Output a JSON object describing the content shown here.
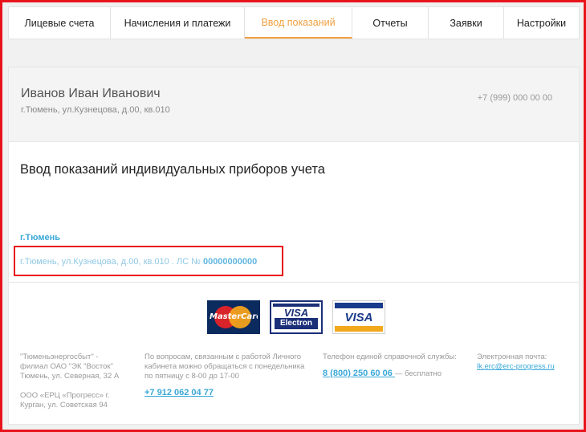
{
  "nav": {
    "tabs": [
      {
        "label": "Лицевые счета"
      },
      {
        "label": "Начисления и платежи"
      },
      {
        "label": "Ввод показаний"
      },
      {
        "label": "Отчеты"
      },
      {
        "label": "Заявки"
      },
      {
        "label": "Настройки"
      }
    ],
    "active_tab": "Ввод показаний"
  },
  "user": {
    "name": "Иванов Иван Иванович",
    "address": "г.Тюмень, ул.Кузнецова,  д.00, кв.010",
    "phone": "+7 (999) 000 00 00"
  },
  "main": {
    "title": "Ввод показаний индивидуальных приборов учета",
    "city": "г.Тюмень",
    "account_address": "г.Тюмень, ул.Кузнецова,  д.00, кв.010 . ЛС № ",
    "account_number": "00000000000"
  },
  "payment_cards": [
    {
      "name": "MasterCard",
      "label": "MasterCard"
    },
    {
      "name": "Visa Electron",
      "label_top": "VISA",
      "label_bottom": "Electron"
    },
    {
      "name": "Visa",
      "label": "VISA"
    }
  ],
  "footer": {
    "org1": "\"Тюменьэнергосбыт\" - филиал ОАО \"ЭК \"Восток\" Тюмень, ул. Северная, 32 А",
    "org2": "ООО «ЕРЦ «Прогресс» г. Курган, ул. Советская 94",
    "cabinet_text": "По вопросам, связанным с работой Личного кабинета можно обращаться с понедельника по пятницу с 8-00 до 17-00",
    "cabinet_phone": "+7 912 062 04 77",
    "helpline_label": "Телефон единой справочной службы:",
    "helpline_phone": "8 (800) 250 60 06 ",
    "helpline_note": "— бесплатно",
    "email_label": "Электронная почта:",
    "email": "lk.erc@erc-progress.ru"
  },
  "colors": {
    "accent_orange": "#f0a040",
    "link_blue": "#3aa8d8",
    "highlight_red": "#e8141c"
  }
}
